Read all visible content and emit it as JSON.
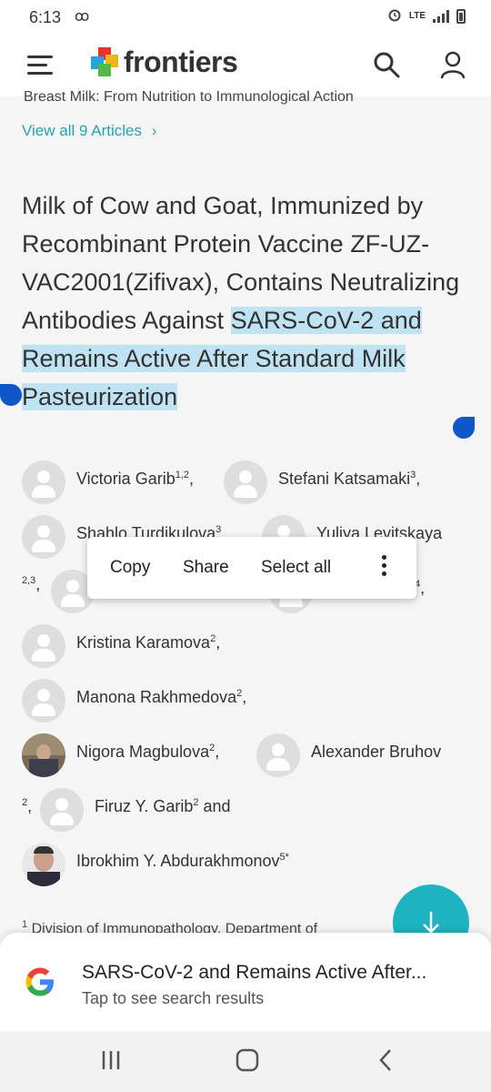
{
  "status": {
    "time": "6:13",
    "voicemail": "ꝏ",
    "network": "LTE"
  },
  "header": {
    "brand": "frontiers"
  },
  "collection_title": "Breast Milk: From Nutrition to Immunological Action",
  "view_all": "View all 9 Articles",
  "view_all_chevron": "›",
  "article": {
    "title_plain": "Milk of Cow and Goat, Immunized by Recombinant Protein Vaccine ZF-UZ-VAC2001(Zifivax), Contains Neutralizing Antibodies Against",
    "title_highlight": "SARS-CoV-2 and Remains Active After Standard Milk Pasteurization"
  },
  "authors": {
    "a1": {
      "name": "Victoria Garib",
      "sup": "1,2",
      "tail": ","
    },
    "a2": {
      "name": "Stefani Katsamaki",
      "sup": "3",
      "tail": ","
    },
    "a3": {
      "name": "Shahlo Turdikulova",
      "sup": "3",
      "tail": ""
    },
    "a4": {
      "name": "Yuliya Levitskaya",
      "sup": "",
      "tail": ""
    },
    "a4_cont": {
      "sup": "2,3",
      "tail": ","
    },
    "a5_cont": {
      "sup": "4",
      "tail": ","
    },
    "a6": {
      "name": "Kristina Karamova",
      "sup": "2",
      "tail": ","
    },
    "a7": {
      "name": "Manona Rakhmedova",
      "sup": "2",
      "tail": ","
    },
    "a8": {
      "name": "Nigora Magbulova",
      "sup": "2",
      "tail": ","
    },
    "a9": {
      "name": "Alexander Bruhov",
      "sup": "",
      "tail": ""
    },
    "a9_cont": {
      "sup": "2",
      "tail": ","
    },
    "a10": {
      "name": "Firuz Y. Garib",
      "sup": "2",
      "tail": " and"
    },
    "a11": {
      "name": "Ibrokhim Y. Abdurakhmonov",
      "sup": "5*",
      "tail": ""
    }
  },
  "context_menu": {
    "copy": "Copy",
    "share": "Share",
    "select_all": "Select all"
  },
  "footnote": {
    "num": "1",
    "text": "Division of Immunopathology, Department of"
  },
  "google_sheet": {
    "query": "SARS-CoV-2 and Remains Active After...",
    "subtitle": "Tap to see search results"
  },
  "colors": {
    "accent": "#2aa0b4",
    "highlight": "#bfe3f2",
    "handle": "#0d57c9",
    "fab": "#1fb3c1"
  }
}
